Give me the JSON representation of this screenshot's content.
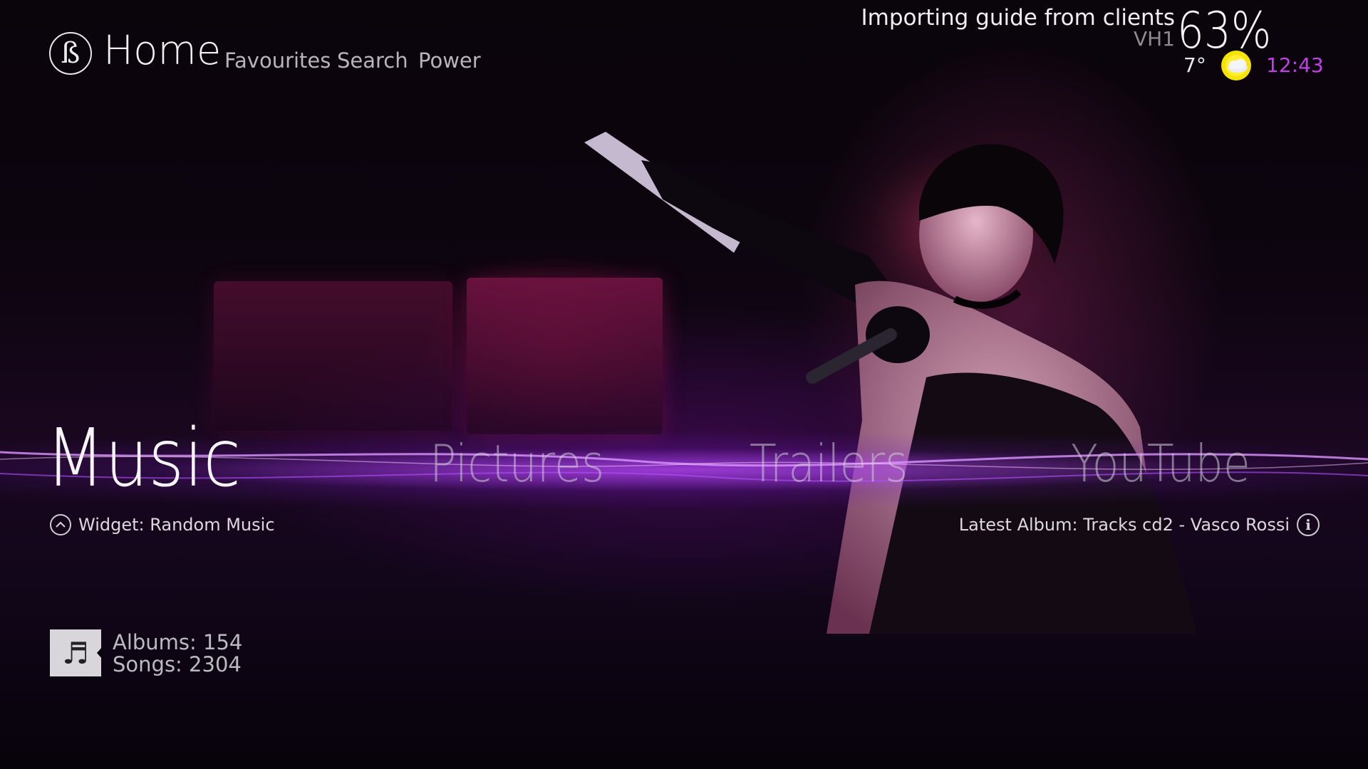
{
  "header": {
    "logo_glyph": "ß",
    "home_label": "Home",
    "nav": [
      "Favourites",
      "Search",
      "Power"
    ]
  },
  "status": {
    "import_text": "Importing guide from clients",
    "channel": "VH1",
    "progress_label": "63%",
    "temperature": "7°",
    "weather_icon": "partly-cloudy-sun-icon",
    "time": "12:43",
    "accent_color": "#c040e8"
  },
  "menu": {
    "items": [
      "Music",
      "Pictures",
      "Trailers",
      "YouTube"
    ],
    "selected": "Music"
  },
  "widget": {
    "label": "Widget: Random Music",
    "latest": "Latest Album: Tracks cd2 - Vasco Rossi",
    "info_glyph": "i"
  },
  "stats": {
    "albums": "Albums: 154",
    "songs": "Songs: 2304",
    "music_glyph": "♬"
  }
}
